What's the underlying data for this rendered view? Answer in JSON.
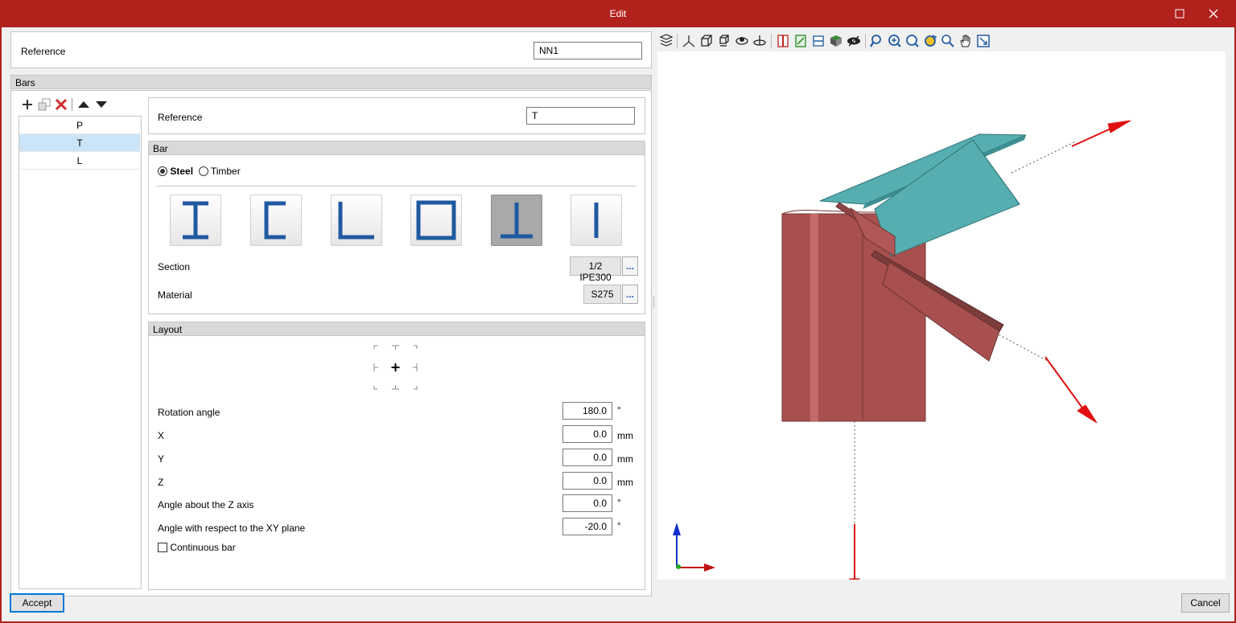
{
  "window": {
    "title": "Edit"
  },
  "top": {
    "reference_label": "Reference",
    "reference_value": "NN1"
  },
  "bars": {
    "header": "Bars",
    "items": [
      {
        "label": "P"
      },
      {
        "label": "T"
      },
      {
        "label": "L"
      }
    ],
    "selected": "T"
  },
  "detail": {
    "reference_label": "Reference",
    "reference_value": "T",
    "bar_header": "Bar",
    "material_type": {
      "steel": "Steel",
      "timber": "Timber",
      "selected": "Steel"
    },
    "section_shapes": [
      "i-section-icon",
      "channel-section-icon",
      "angle-section-icon",
      "box-section-icon",
      "tee-section-icon",
      "flat-bar-icon"
    ],
    "selected_shape": "tee-section-icon",
    "section_label": "Section",
    "section_value": "1/2 IPE300",
    "material_label": "Material",
    "material_value": "S275",
    "dots": "..."
  },
  "layout": {
    "header": "Layout",
    "fields": [
      {
        "label": "Rotation angle",
        "value": "180.0",
        "unit": "°"
      },
      {
        "label": "X",
        "value": "0.0",
        "unit": "mm"
      },
      {
        "label": "Y",
        "value": "0.0",
        "unit": "mm"
      },
      {
        "label": "Z",
        "value": "0.0",
        "unit": "mm"
      },
      {
        "label": "Angle about the Z axis",
        "value": "0.0",
        "unit": "°"
      },
      {
        "label": "Angle with respect to the XY plane",
        "value": "-20.0",
        "unit": "°"
      }
    ],
    "continuous_bar_label": "Continuous bar",
    "continuous_bar_checked": false
  },
  "footer": {
    "accept": "Accept",
    "cancel": "Cancel"
  },
  "colors": {
    "accent": "#b1221d",
    "steel_red": "#a85050",
    "beam_teal": "#56aeb0",
    "axis_red": "#e01010"
  }
}
